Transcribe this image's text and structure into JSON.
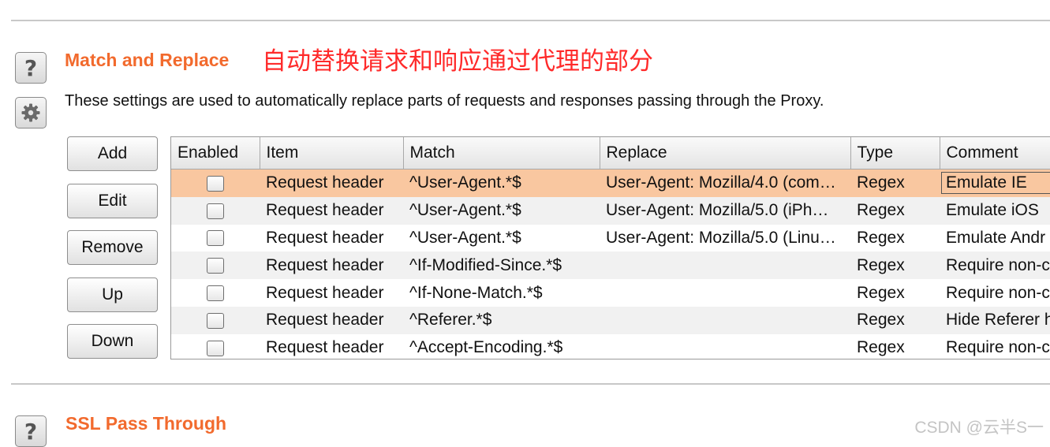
{
  "match_replace": {
    "title": "Match and Replace",
    "annotation": "自动替换请求和响应通过代理的部分",
    "description": "These settings are used to automatically replace parts of requests and responses passing through the Proxy.",
    "help_glyph": "?",
    "buttons": {
      "add": "Add",
      "edit": "Edit",
      "remove": "Remove",
      "up": "Up",
      "down": "Down"
    },
    "table": {
      "columns": [
        "Enabled",
        "Item",
        "Match",
        "Replace",
        "Type",
        "Comment"
      ],
      "rows": [
        {
          "enabled": false,
          "item": "Request header",
          "match": "^User-Agent.*$",
          "replace": "User-Agent: Mozilla/4.0 (com…",
          "type": "Regex",
          "comment": "Emulate IE",
          "selected": true
        },
        {
          "enabled": false,
          "item": "Request header",
          "match": "^User-Agent.*$",
          "replace": "User-Agent: Mozilla/5.0 (iPh…",
          "type": "Regex",
          "comment": "Emulate iOS",
          "selected": false
        },
        {
          "enabled": false,
          "item": "Request header",
          "match": "^User-Agent.*$",
          "replace": "User-Agent: Mozilla/5.0 (Linu…",
          "type": "Regex",
          "comment": "Emulate Andr",
          "selected": false
        },
        {
          "enabled": false,
          "item": "Request header",
          "match": "^If-Modified-Since.*$",
          "replace": "",
          "type": "Regex",
          "comment": "Require non-c",
          "selected": false
        },
        {
          "enabled": false,
          "item": "Request header",
          "match": "^If-None-Match.*$",
          "replace": "",
          "type": "Regex",
          "comment": "Require non-c",
          "selected": false
        },
        {
          "enabled": false,
          "item": "Request header",
          "match": "^Referer.*$",
          "replace": "",
          "type": "Regex",
          "comment": "Hide Referer h",
          "selected": false
        },
        {
          "enabled": false,
          "item": "Request header",
          "match": "^Accept-Encoding.*$",
          "replace": "",
          "type": "Regex",
          "comment": "Require non-c",
          "selected": false
        }
      ]
    }
  },
  "ssl_pass_through": {
    "title": "SSL Pass Through",
    "help_glyph": "?"
  },
  "watermark": "CSDN @云半S一",
  "colors": {
    "section_title": "#f26a2d",
    "annotation": "#ff2a2a",
    "selected_row": "#f9c7a0",
    "alt_row": "#f1f1f1"
  },
  "icons": {
    "help": "help-icon",
    "settings": "gear-icon"
  }
}
